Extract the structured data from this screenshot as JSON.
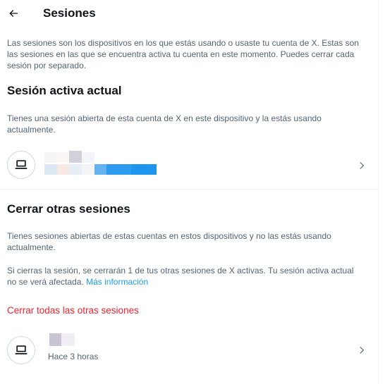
{
  "header": {
    "title": "Sesiones"
  },
  "intro": {
    "text": "Las sesiones son los dispositivos en los que estás usando o usaste tu cuenta de X. Estas son las sesiones en las que se encuentra activa tu cuenta en este momento. Puedes cerrar cada sesión por separado."
  },
  "current_session": {
    "title": "Sesión activa actual",
    "description": "Tienes una sesión abierta de esta cuenta de X en este dispositivo y la estás usando actualmente.",
    "device_icon": "laptop-icon"
  },
  "other_sessions": {
    "title": "Cerrar otras sesiones",
    "description": "Tienes sesiones abiertas de estas cuentas en estos dispositivos y no las estás usando actualmente.",
    "notice": "Si cierras la sesión, se cerrarán 1 de tus otras sesiones de X activas. Tu sesión activa actual no se verá afectada.",
    "more_info_link": "Más información",
    "logout_all_label": "Cerrar todas las otras sesiones",
    "sessions": [
      {
        "device_icon": "laptop-icon",
        "last_active": "Hace 3 horas"
      }
    ]
  },
  "colors": {
    "accent": "#1d9bf0",
    "danger": "#f4212e",
    "secondary_text": "#536471"
  }
}
